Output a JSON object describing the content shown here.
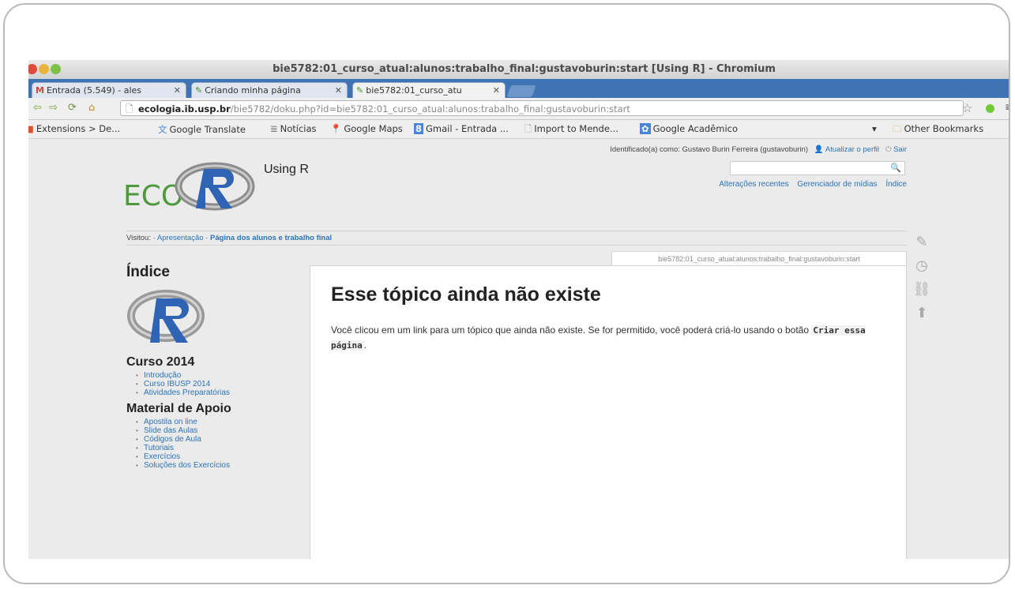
{
  "window": {
    "title": "bie5782:01_curso_atual:alunos:trabalho_final:gustavoburin:start [Using R] - Chromium",
    "colors": {
      "close": "#e0493b",
      "minimize": "#e9b43b",
      "maximize": "#7cc24a",
      "tabstrip": "#3f73b4",
      "link": "#2b73b7"
    }
  },
  "tabs": [
    {
      "icon": "gmail-icon",
      "label": "Entrada (5.549) - ales"
    },
    {
      "icon": "dokuwiki-icon",
      "label": "Criando minha página"
    },
    {
      "icon": "dokuwiki-icon",
      "label": "bie5782:01_curso_atu"
    }
  ],
  "address": {
    "host": "ecologia.ib.usp.br",
    "path": "/bie5782/doku.php?id=bie5782:01_curso_atual:alunos:trabalho_final:gustavoburin:start"
  },
  "bookmarks": [
    {
      "icon": "extensions-icon",
      "label": "Extensions > De..."
    },
    {
      "icon": "translate-icon",
      "label": "Google Translate"
    },
    {
      "icon": "news-icon",
      "label": "Notícias"
    },
    {
      "icon": "maps-icon",
      "label": "Google Maps"
    },
    {
      "icon": "gmail-icon",
      "label": "Gmail - Entrada ..."
    },
    {
      "icon": "page-icon",
      "label": "Import to Mende..."
    },
    {
      "icon": "scholar-icon",
      "label": "Google Acadêmico"
    }
  ],
  "other_bookmarks": "Other Bookmarks",
  "wiki": {
    "logged_in": "Identificado(a) como: Gustavo Burin Ferreira (gustavoburin)",
    "update_profile": "Atualizar o perfil",
    "logout": "Sair",
    "logo_text": "ECO",
    "site_name": "Using R",
    "top_links": [
      "Alterações recentes",
      "Gerenciador de mídias",
      "Índice"
    ],
    "breadcrumb_label": "Visitou:",
    "breadcrumb_1": "Apresentação",
    "breadcrumb_2": "Página dos alunos e trabalho final",
    "page_id": "bie5782:01_curso_atual:alunos:trabalho_final:gustavoburin:start",
    "heading": "Esse tópico ainda não existe",
    "message": "Você clicou em um link para um tópico que ainda não existe. Se for permitido, você poderá criá-lo usando o botão ",
    "button_name": "Criar essa página",
    "message_end": "."
  },
  "sidebar": {
    "index_title": "Índice",
    "section1": "Curso 2014",
    "section1_items": [
      "Introdução",
      "Curso IBUSP 2014",
      "Atividades Preparatórias"
    ],
    "section2": "Material de Apoio",
    "section2_items": [
      "Apostila on line",
      "Slide das Aulas",
      "Códigos de Aula",
      "Tutoriais",
      "Exercícios",
      "Soluções dos Exercícios"
    ]
  }
}
